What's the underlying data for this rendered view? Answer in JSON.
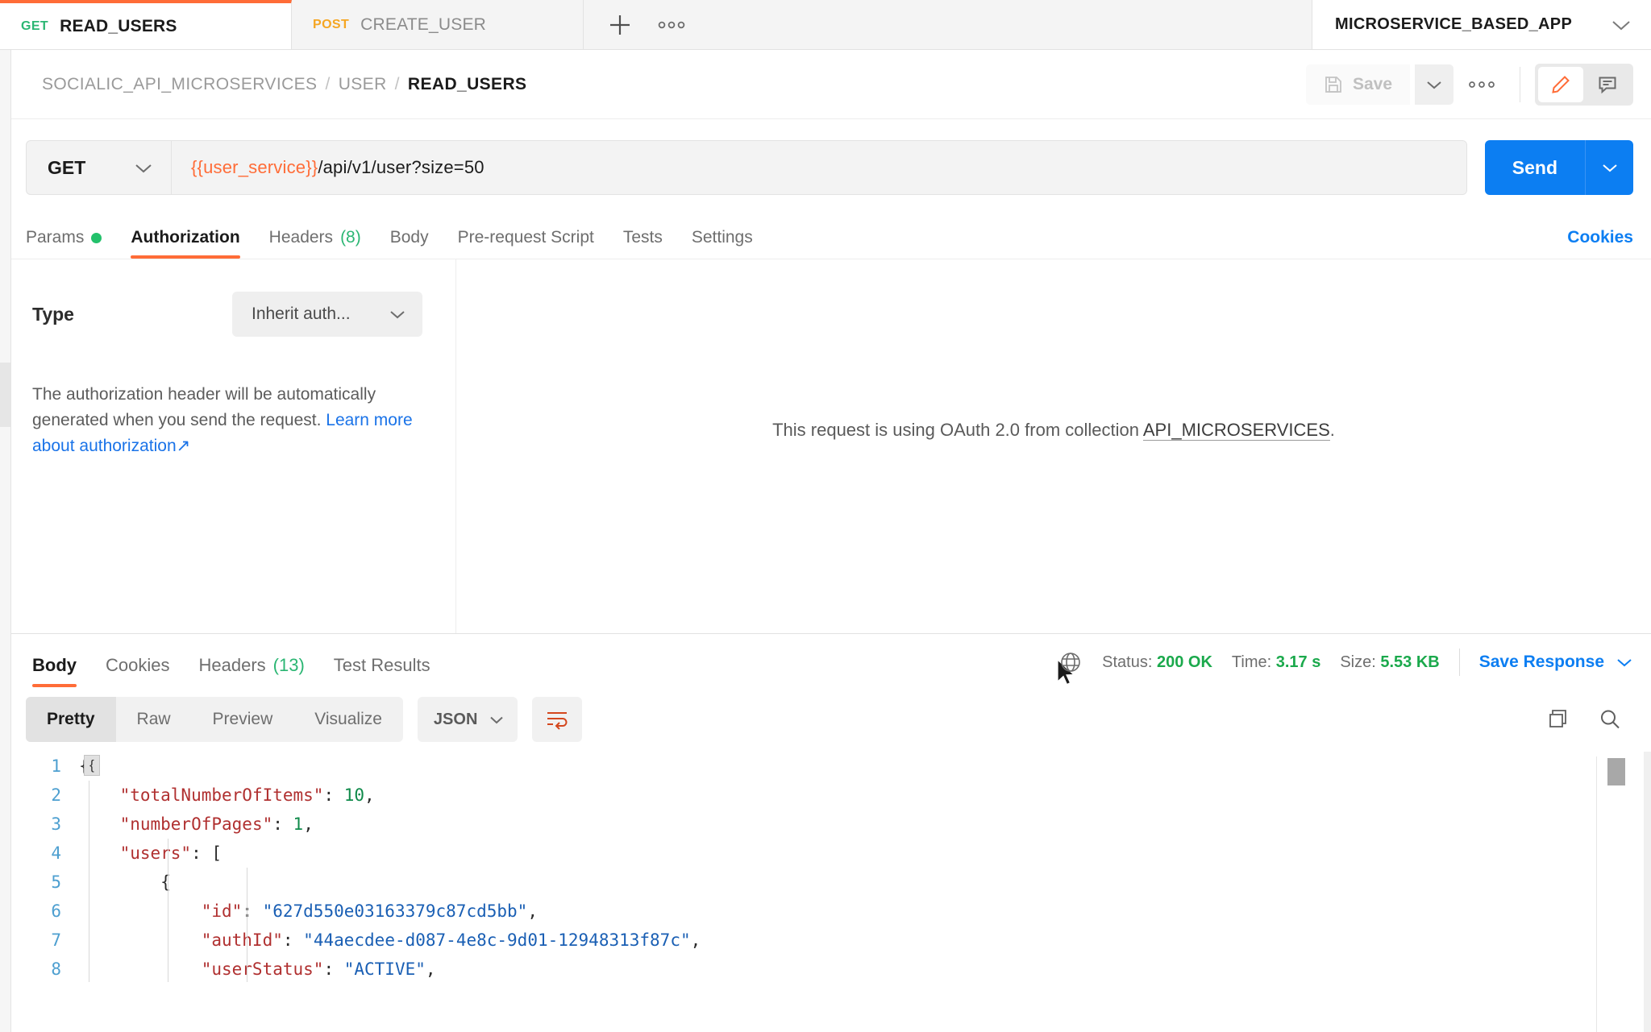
{
  "tabs": [
    {
      "method": "GET",
      "method_class": "get",
      "name": "READ_USERS",
      "active": true
    },
    {
      "method": "POST",
      "method_class": "post",
      "name": "CREATE_USER",
      "active": false
    }
  ],
  "tabbar": {
    "add_tab_label": "+",
    "more_label": "●●●",
    "workspace_name": "MICROSERVICE_BASED_APP"
  },
  "breadcrumb": {
    "collection": "SOCIALIC_API_MICROSERVICES",
    "folder": "USER",
    "request": "READ_USERS",
    "separator": "/"
  },
  "actions": {
    "save_label": "Save",
    "more_label": "●●●"
  },
  "request": {
    "method": "GET",
    "url_variable": "{{user_service}}",
    "url_path": "/api/v1/user?size=50",
    "send_label": "Send"
  },
  "request_tabs": [
    {
      "label": "Params",
      "badge": "",
      "dot": true,
      "active": false
    },
    {
      "label": "Authorization",
      "badge": "",
      "dot": false,
      "active": true
    },
    {
      "label": "Headers",
      "badge": "(8)",
      "dot": false,
      "active": false
    },
    {
      "label": "Body",
      "badge": "",
      "dot": false,
      "active": false
    },
    {
      "label": "Pre-request Script",
      "badge": "",
      "dot": false,
      "active": false
    },
    {
      "label": "Tests",
      "badge": "",
      "dot": false,
      "active": false
    },
    {
      "label": "Settings",
      "badge": "",
      "dot": false,
      "active": false
    }
  ],
  "cookies_link": "Cookies",
  "auth": {
    "type_label": "Type",
    "type_value": "Inherit auth...",
    "help_text": "The authorization header will be automatically generated when you send the request. ",
    "help_link": "Learn more about authorization",
    "help_link_arrow": "↗",
    "oauth_prefix": "This request is using OAuth 2.0 from collection ",
    "oauth_collection": "API_MICROSERVICES",
    "oauth_suffix": "."
  },
  "response_tabs": [
    {
      "label": "Body",
      "badge": "",
      "active": true
    },
    {
      "label": "Cookies",
      "badge": "",
      "active": false
    },
    {
      "label": "Headers",
      "badge": "(13)",
      "active": false
    },
    {
      "label": "Test Results",
      "badge": "",
      "active": false
    }
  ],
  "response_meta": {
    "status_label": "Status:",
    "status_value": "200 OK",
    "time_label": "Time:",
    "time_value": "3.17 s",
    "size_label": "Size:",
    "size_value": "5.53 KB",
    "save_response_label": "Save Response"
  },
  "response_toolbar": {
    "views": [
      {
        "label": "Pretty",
        "active": true
      },
      {
        "label": "Raw",
        "active": false
      },
      {
        "label": "Preview",
        "active": false
      },
      {
        "label": "Visualize",
        "active": false
      }
    ],
    "format": "JSON"
  },
  "response_body": {
    "line_numbers": [
      "1",
      "2",
      "3",
      "4",
      "5",
      "6",
      "7",
      "8"
    ],
    "fold_glyph": "{",
    "lines": [
      {
        "indent": 0,
        "segments": [
          {
            "t": "{",
            "c": "p"
          }
        ]
      },
      {
        "indent": 1,
        "segments": [
          {
            "t": "\"totalNumberOfItems\"",
            "c": "k"
          },
          {
            "t": ": ",
            "c": "p"
          },
          {
            "t": "10",
            "c": "n"
          },
          {
            "t": ",",
            "c": "p"
          }
        ]
      },
      {
        "indent": 1,
        "segments": [
          {
            "t": "\"numberOfPages\"",
            "c": "k"
          },
          {
            "t": ": ",
            "c": "p"
          },
          {
            "t": "1",
            "c": "n"
          },
          {
            "t": ",",
            "c": "p"
          }
        ]
      },
      {
        "indent": 1,
        "segments": [
          {
            "t": "\"users\"",
            "c": "k"
          },
          {
            "t": ": [",
            "c": "p"
          }
        ]
      },
      {
        "indent": 2,
        "segments": [
          {
            "t": "{",
            "c": "p"
          }
        ]
      },
      {
        "indent": 3,
        "segments": [
          {
            "t": "\"id\"",
            "c": "k"
          },
          {
            "t": ": ",
            "c": "p"
          },
          {
            "t": "\"627d550e03163379c87cd5bb\"",
            "c": "s"
          },
          {
            "t": ",",
            "c": "p"
          }
        ]
      },
      {
        "indent": 3,
        "segments": [
          {
            "t": "\"authId\"",
            "c": "k"
          },
          {
            "t": ": ",
            "c": "p"
          },
          {
            "t": "\"44aecdee-d087-4e8c-9d01-12948313f87c\"",
            "c": "s"
          },
          {
            "t": ",",
            "c": "p"
          }
        ]
      },
      {
        "indent": 3,
        "segments": [
          {
            "t": "\"userStatus\"",
            "c": "k"
          },
          {
            "t": ": ",
            "c": "p"
          },
          {
            "t": "\"ACTIVE\"",
            "c": "s"
          },
          {
            "t": ",",
            "c": "p"
          }
        ]
      }
    ]
  },
  "colors": {
    "accent": "#ff6c37",
    "link": "#0c7ef2",
    "success": "#1ba94c",
    "get": "#2bb673",
    "post": "#f5a623"
  }
}
